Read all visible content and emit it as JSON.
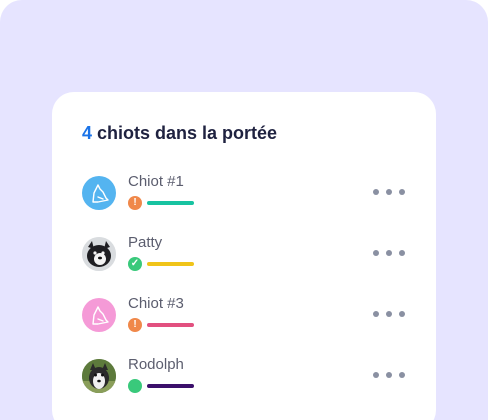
{
  "litter": {
    "count": "4",
    "title_text": " chiots dans la portée"
  },
  "puppies": [
    {
      "name": "Chiot #1",
      "status": "warning",
      "status_glyph": "!",
      "avatar": "dog-silhouette-icon",
      "avatar_color": "#54b4f0",
      "bar_color": "#17c3a1"
    },
    {
      "name": "Patty",
      "status": "ok",
      "status_glyph": "✓",
      "avatar": "dog-photo",
      "avatar_color": "#e5e7ea",
      "bar_color": "#f0c419"
    },
    {
      "name": "Chiot #3",
      "status": "warning",
      "status_glyph": "!",
      "avatar": "dog-silhouette-icon",
      "avatar_color": "#f59ad7",
      "bar_color": "#e2507f"
    },
    {
      "name": "Rodolph",
      "status": "neutral",
      "status_glyph": "",
      "avatar": "dog-photo",
      "avatar_color": "#6e8a4a",
      "bar_color": "#3b0f6b"
    }
  ],
  "colors": {
    "background": "#e6e4ff",
    "accent": "#1a73e8",
    "warning": "#f0884a",
    "ok": "#39c97b"
  }
}
